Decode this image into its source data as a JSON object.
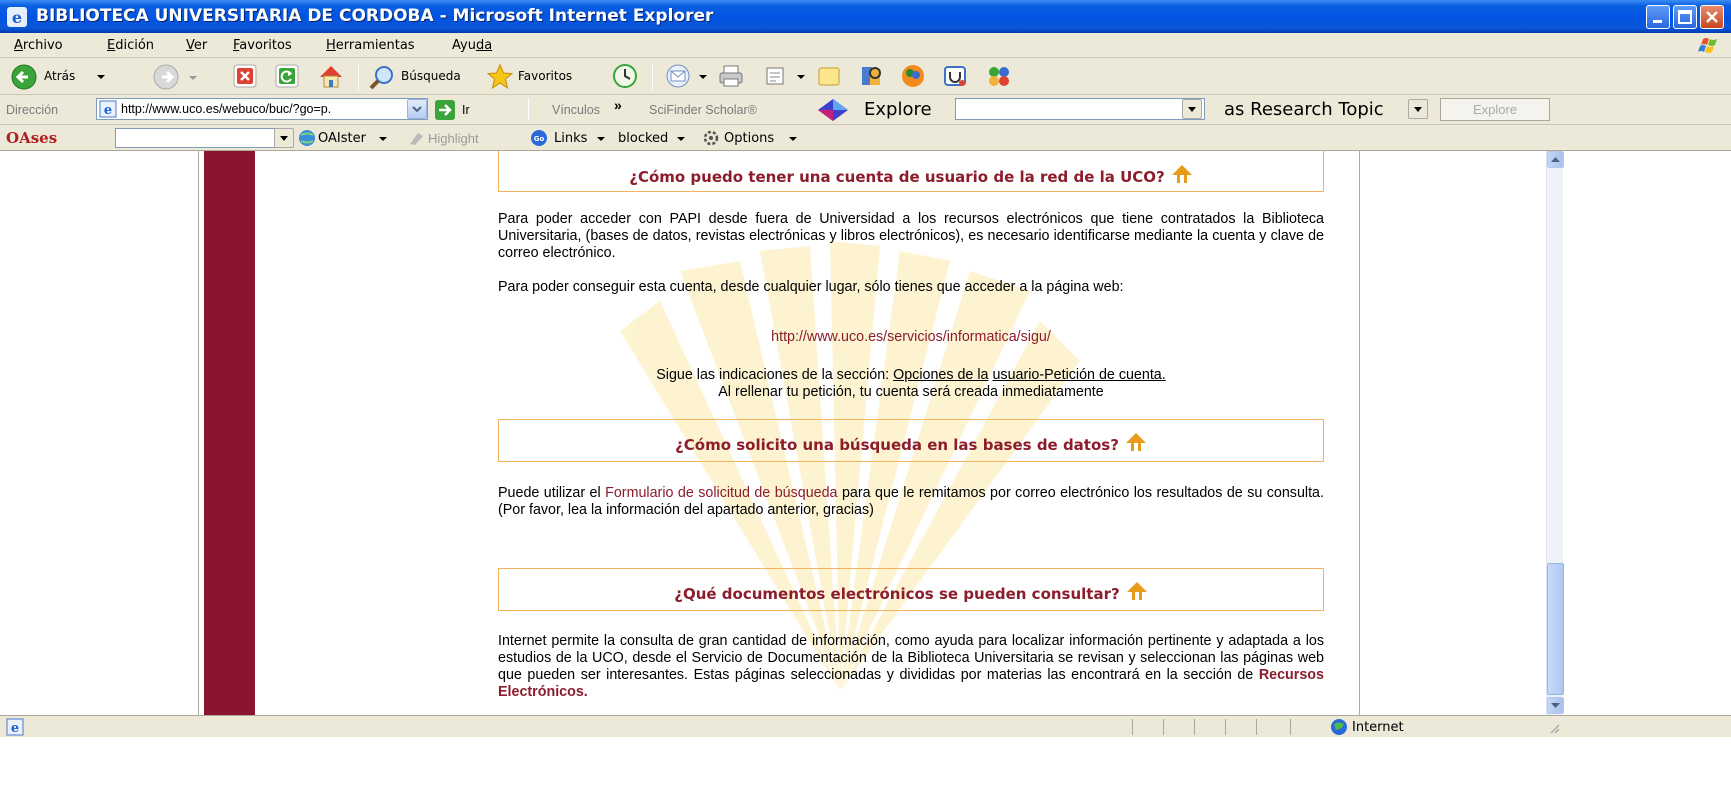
{
  "window": {
    "title": "BIBLIOTECA UNIVERSITARIA DE CORDOBA - Microsoft Internet Explorer"
  },
  "menu": [
    {
      "first": "A",
      "rest": "rchivo"
    },
    {
      "first": "E",
      "rest": "dición"
    },
    {
      "first": "V",
      "rest": "er"
    },
    {
      "first": "F",
      "rest": "avoritos"
    },
    {
      "first": "H",
      "rest": "erramientas"
    },
    {
      "first": "Ayu",
      "rest": "da",
      "ul_last": true
    }
  ],
  "toolbar": {
    "back_label": "Atrás",
    "search_label": "Búsqueda",
    "favorites_label": "Favoritos"
  },
  "address": {
    "label": "Dirección",
    "url": "http://www.uco.es/webuco/buc/?go=p.",
    "go_label": "Ir",
    "links_label": "Vínculos",
    "chevron": "»",
    "scifinder": "SciFinder Scholar®",
    "explore": "Explore",
    "research_topic": "as Research Topic",
    "explore_button": "Explore"
  },
  "oases": {
    "brand": "OAses",
    "oaister": "OAIster",
    "highlight": "Highlight",
    "links": "Links",
    "blocked": "blocked",
    "options": "Options"
  },
  "content": {
    "q1": "¿Cómo puedo tener una cuenta de usuario de la red de la UCO?",
    "p1": "Para poder acceder con PAPI desde fuera de Universidad a los recursos electrónicos que tiene contratados la Biblioteca Universitaria, (bases de datos, revistas electrónicas y libros electrónicos), es necesario identificarse mediante la cuenta y clave de correo electrónico.",
    "p2": "Para poder conseguir esta cuenta, desde cualquier lugar, sólo tienes que acceder a la página web:",
    "sigu_url": "http://www.uco.es/servicios/informatica/sigu/",
    "sigue_prefix": "Sigue las indicaciones de la sección: ",
    "opciones_link": "Opciones de la",
    "usuario_link": "usuario-Petición de cuenta.",
    "rellenar": "Al rellenar tu petición, tu cuenta será creada inmediatamente",
    "q2": "¿Cómo solicito una búsqueda en las bases de datos?",
    "p3_a": "Puede utilizar el ",
    "p3_link": "Formulario de solicitud de búsqueda",
    "p3_b": "  para que le remitamos por correo electrónico los resultados de su consulta. (Por favor, lea la información del apartado anterior, gracias)",
    "q3": "¿Qué documentos electrónicos se pueden consultar?",
    "p4_a": "Internet permite la consulta de  gran cantidad de información, como ayuda para localizar información pertinente y adaptada a los estudios de la UCO, desde el Servicio de Documentación de la Biblioteca Universitaria  se revisan y seleccionan  las páginas web que pueden ser interesantes. Estas páginas seleccionadas y divididas por materias las encontrará  en la sección de ",
    "p4_link": "Recursos Electrónicos."
  },
  "status": {
    "zone": "Internet"
  }
}
